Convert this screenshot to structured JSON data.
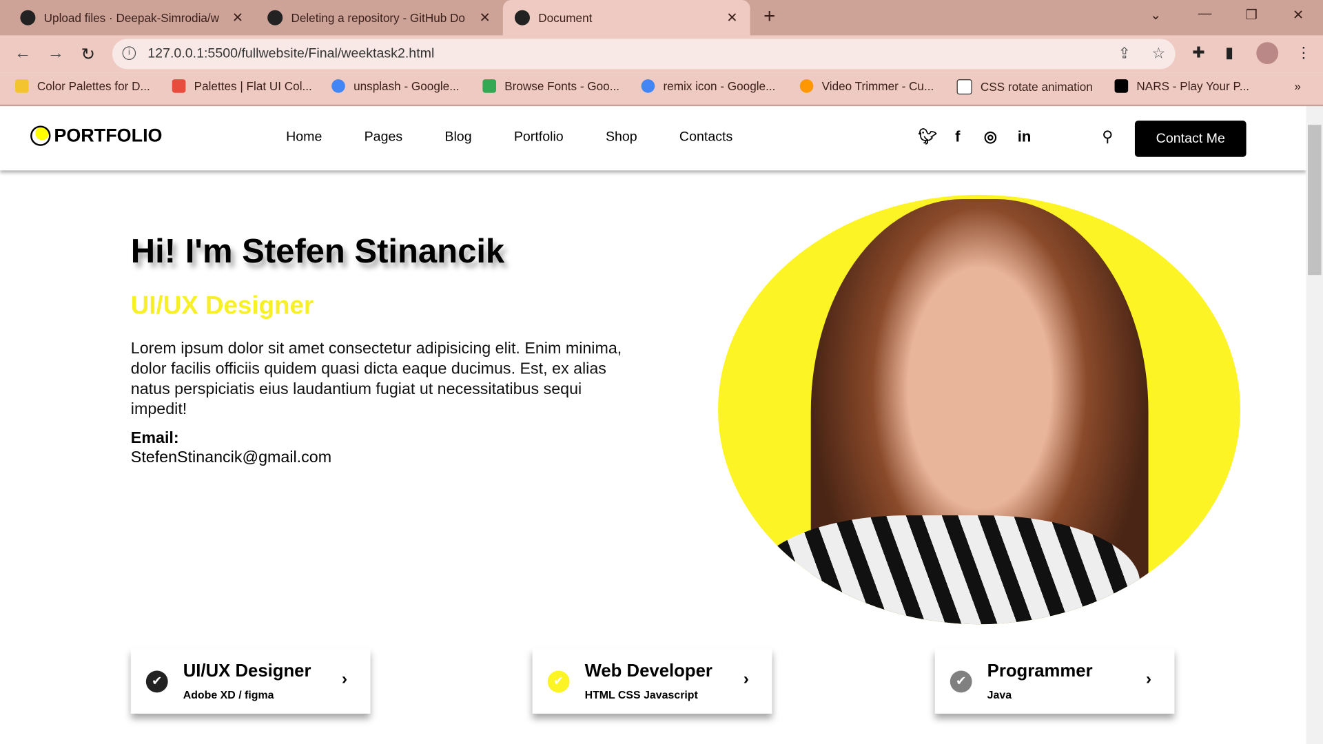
{
  "browser": {
    "tabs": [
      {
        "title": "Upload files · Deepak-Simrodia/w",
        "active": false
      },
      {
        "title": "Deleting a repository - GitHub Do",
        "active": false
      },
      {
        "title": "Document",
        "active": true
      }
    ],
    "url": "127.0.0.1:5500/fullwebsite/Final/weektask2.html",
    "bookmarks": [
      {
        "label": "Color Palettes for D...",
        "color": "#f4c430"
      },
      {
        "label": "Palettes | Flat UI Col...",
        "color": "#e74c3c"
      },
      {
        "label": "unsplash - Google...",
        "color": "#4285f4"
      },
      {
        "label": "Browse Fonts - Goo...",
        "color": "#34a853"
      },
      {
        "label": "remix icon - Google...",
        "color": "#4285f4"
      },
      {
        "label": "Video Trimmer - Cu...",
        "color": "#ff9800"
      },
      {
        "label": "CSS rotate animation",
        "color": "#ffffff"
      },
      {
        "label": "NARS - Play Your P...",
        "color": "#000000"
      }
    ],
    "more": "»"
  },
  "site": {
    "logo": "PORTFOLIO",
    "nav": [
      "Home",
      "Pages",
      "Blog",
      "Portfolio",
      "Shop",
      "Contacts"
    ],
    "social": [
      "twitter-icon",
      "facebook-icon",
      "instagram-icon",
      "linkedin-icon"
    ],
    "contact_button": "Contact Me",
    "hero": {
      "title": "Hi! I'm Stefen Stinancik",
      "role": "UI/UX Designer",
      "description": "Lorem ipsum dolor sit amet consectetur adipisicing elit. Enim minima, dolor facilis officiis quidem quasi dicta eaque ducimus. Est, ex alias natus perspiciatis eius laudantium fugiat ut necessitatibus sequi impedit!",
      "email_label": "Email:",
      "email": "StefenStinancik@gmail.com"
    },
    "cards": [
      {
        "title": "UI/UX Designer",
        "subtitle": "Adobe XD / figma",
        "color": "#222222"
      },
      {
        "title": "Web Developer",
        "subtitle": "HTML CSS Javascript",
        "color": "#fcf424"
      },
      {
        "title": "Programmer",
        "subtitle": "Java",
        "color": "#808080"
      }
    ],
    "accent": "#fcf424"
  }
}
